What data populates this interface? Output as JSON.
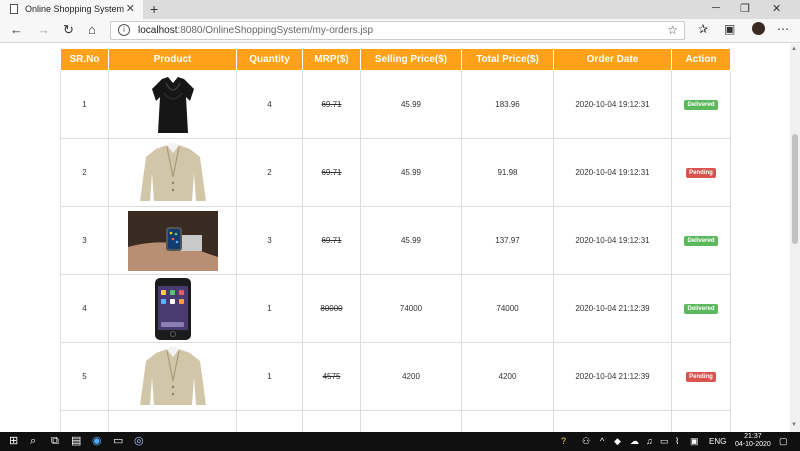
{
  "browser": {
    "tab_title": "Online Shopping System",
    "url_host": "localhost",
    "url_rest": ":8080/OnlineShoppingSystem/my-orders.jsp"
  },
  "table": {
    "headers": [
      "SR.No",
      "Product",
      "Quantity",
      "MRP($)",
      "Selling Price($)",
      "Total Price($)",
      "Order Date",
      "Action"
    ],
    "rows": [
      {
        "sr": "1",
        "product_image": "black-blouse",
        "quantity": "4",
        "mrp": "69.71",
        "selling_price": "45.99",
        "total_price": "183.96",
        "order_date": "2020-10-04 19:12:31",
        "status": "Delivered"
      },
      {
        "sr": "2",
        "product_image": "beige-blazer",
        "quantity": "2",
        "mrp": "69.71",
        "selling_price": "45.99",
        "total_price": "91.98",
        "order_date": "2020-10-04 19:12:31",
        "status": "Pending"
      },
      {
        "sr": "3",
        "product_image": "smart-watch",
        "quantity": "3",
        "mrp": "69.71",
        "selling_price": "45.99",
        "total_price": "137.97",
        "order_date": "2020-10-04 19:12:31",
        "status": "Delivered"
      },
      {
        "sr": "4",
        "product_image": "iphone",
        "quantity": "1",
        "mrp": "80000",
        "selling_price": "74000",
        "total_price": "74000",
        "order_date": "2020-10-04 21:12:39",
        "status": "Delivered"
      },
      {
        "sr": "5",
        "product_image": "beige-blazer",
        "quantity": "1",
        "mrp": "4575",
        "selling_price": "4200",
        "total_price": "4200",
        "order_date": "2020-10-04 21:12:39",
        "status": "Pending"
      }
    ]
  },
  "taskbar": {
    "language": "ENG",
    "time": "21:37",
    "date": "04-10-2020"
  },
  "colors": {
    "header_bg": "#ffa21a",
    "delivered": "#5cb85c",
    "pending": "#d9534f"
  }
}
